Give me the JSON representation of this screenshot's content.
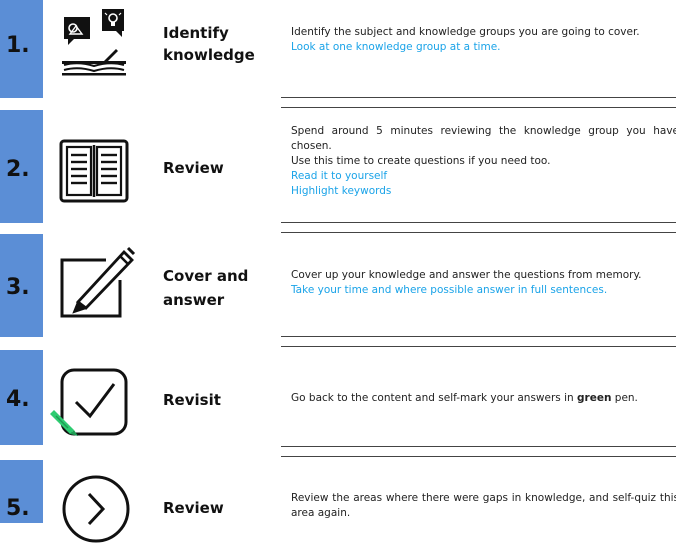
{
  "steps": [
    {
      "number": "1.",
      "title_line1": "Identify",
      "title_line2": "knowledge",
      "text": "Identify the subject and knowledge groups you are going to cover.",
      "blue": [
        "Look at one knowledge group at a time."
      ]
    },
    {
      "number": "2.",
      "title_line1": "Review",
      "text": "Spend around 5 minutes reviewing the knowledge group you have chosen.",
      "text2": "Use this time to create questions if you need too.",
      "blue": [
        "Read it to yourself",
        "Highlight keywords"
      ]
    },
    {
      "number": "3.",
      "title_line1": "Cover and",
      "title_line2": "answer",
      "text": "Cover up your knowledge and answer the questions from memory.",
      "blue": [
        "Take your time and where possible answer in full sentences."
      ]
    },
    {
      "number": "4.",
      "title_line1": "Revisit",
      "text_before": "Go back to the content and self-mark your answers in ",
      "text_bold": "green",
      "text_after": " pen."
    },
    {
      "number": "5.",
      "title_line1": "Review",
      "text": "Review the areas where there were gaps in knowledge, and self-quiz this area again."
    }
  ],
  "colors": {
    "number_box": "#5b8ed6",
    "link_blue": "#1aa3e8",
    "pen_green": "#2ecc71"
  },
  "icons": [
    "chat-idea-book-icon",
    "open-book-icon",
    "pencil-square-icon",
    "checkbox-icon",
    "chevron-circle-icon"
  ]
}
